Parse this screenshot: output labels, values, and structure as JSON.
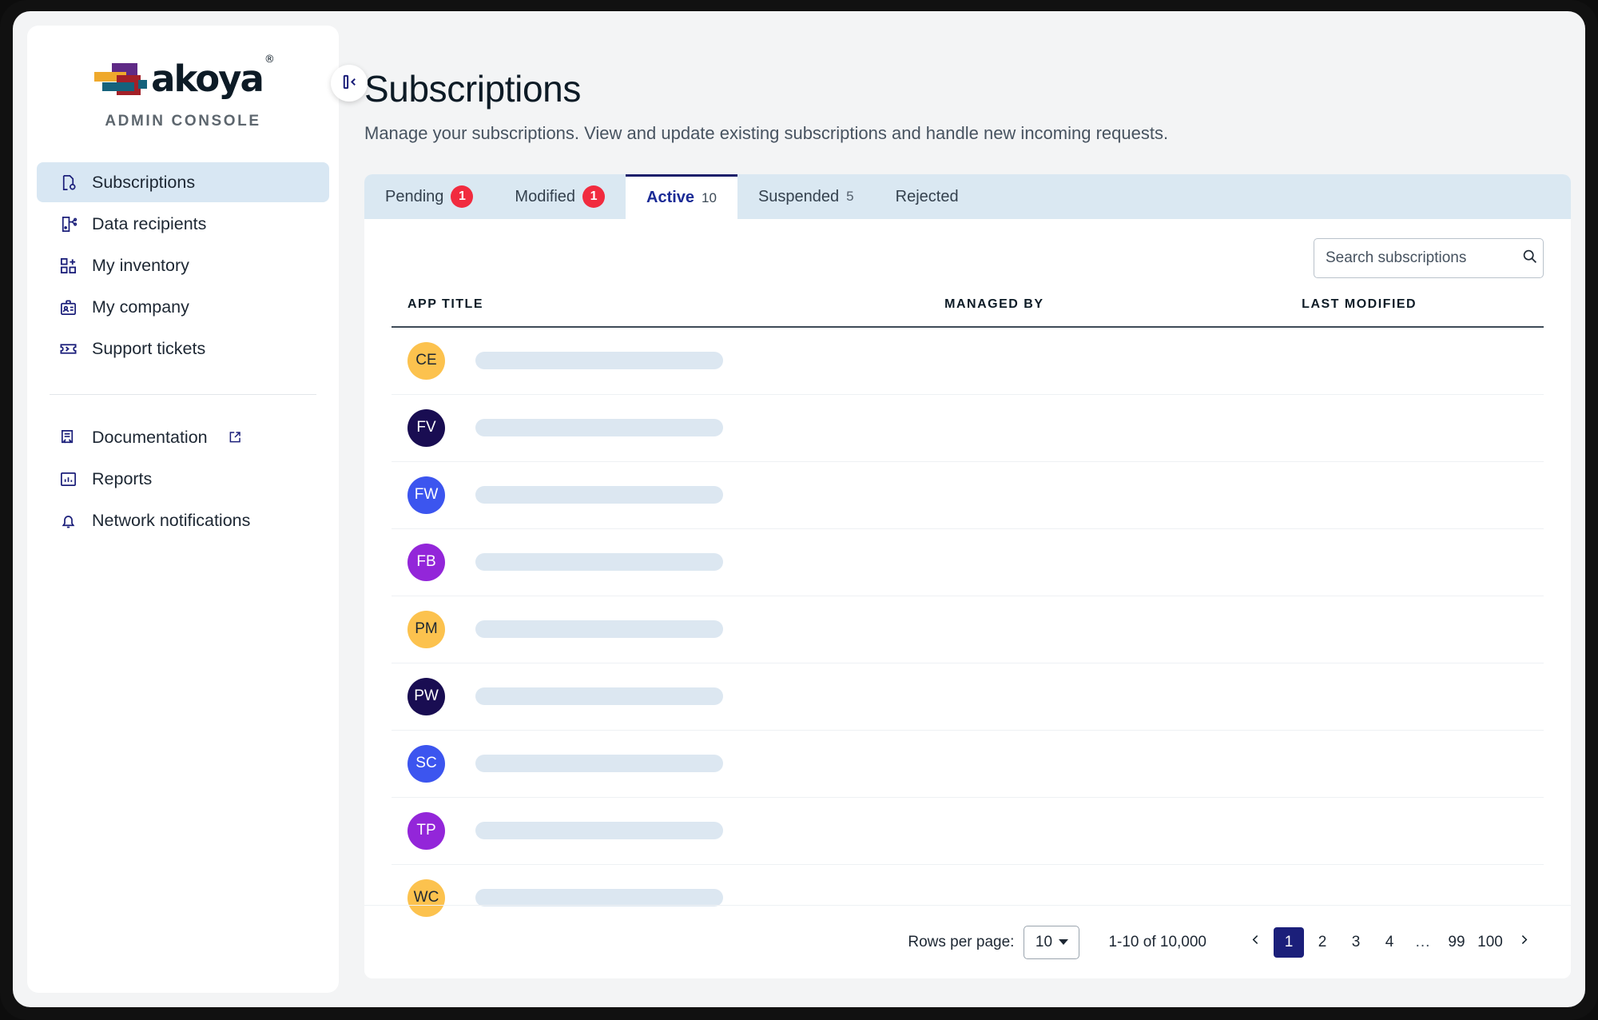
{
  "brand": {
    "logo_word": "akoya",
    "logo_trademark": "®",
    "subtitle": "ADMIN CONSOLE",
    "colors": {
      "purple": "#5f2a86",
      "orange": "#efa92c",
      "red": "#a32028",
      "teal": "#15627c",
      "navy": "#1b1f7a",
      "accent_tab_bg": "#dae8f2",
      "badge_red": "#f12b3f",
      "skeleton": "#dce7f1"
    }
  },
  "sidebar": {
    "collapse_button": "collapse-sidebar",
    "primary_items": [
      {
        "label": "Subscriptions",
        "icon": "subscriptions-icon",
        "active": true
      },
      {
        "label": "Data recipients",
        "icon": "data-recipients-icon",
        "active": false
      },
      {
        "label": "My inventory",
        "icon": "inventory-icon",
        "active": false
      },
      {
        "label": "My company",
        "icon": "company-badge-icon",
        "active": false
      },
      {
        "label": "Support tickets",
        "icon": "ticket-icon",
        "active": false
      }
    ],
    "secondary_items": [
      {
        "label": "Documentation",
        "icon": "documentation-icon",
        "external": true
      },
      {
        "label": "Reports",
        "icon": "reports-chart-icon",
        "external": false
      },
      {
        "label": "Network notifications",
        "icon": "bell-icon",
        "external": false
      }
    ]
  },
  "header": {
    "title": "Subscriptions",
    "subtitle": "Manage your subscriptions. View and update existing subscriptions and handle new incoming requests."
  },
  "tabs": [
    {
      "label": "Pending",
      "badge": "1",
      "badge_style": "red",
      "selected": false
    },
    {
      "label": "Modified",
      "badge": "1",
      "badge_style": "red",
      "selected": false
    },
    {
      "label": "Active",
      "badge": "10",
      "badge_style": "plain",
      "selected": true
    },
    {
      "label": "Suspended",
      "badge": "5",
      "badge_style": "plain",
      "selected": false
    },
    {
      "label": "Rejected",
      "badge": "",
      "badge_style": "none",
      "selected": false
    }
  ],
  "search": {
    "placeholder": "Search subscriptions",
    "value": "",
    "icon": "search-icon"
  },
  "table": {
    "columns": [
      "APP TITLE",
      "MANAGED BY",
      "LAST MODIFIED"
    ],
    "rows": [
      {
        "initials": "CE",
        "avatar_color": "#fcc24e",
        "avatar_text_color": "#1d2733"
      },
      {
        "initials": "FV",
        "avatar_color": "#190d52",
        "avatar_text_color": "#ffffff"
      },
      {
        "initials": "FW",
        "avatar_color": "#3c55ef",
        "avatar_text_color": "#ffffff"
      },
      {
        "initials": "FB",
        "avatar_color": "#9326d9",
        "avatar_text_color": "#ffffff"
      },
      {
        "initials": "PM",
        "avatar_color": "#fcc24e",
        "avatar_text_color": "#1d2733"
      },
      {
        "initials": "PW",
        "avatar_color": "#190d52",
        "avatar_text_color": "#ffffff"
      },
      {
        "initials": "SC",
        "avatar_color": "#3c55ef",
        "avatar_text_color": "#ffffff"
      },
      {
        "initials": "TP",
        "avatar_color": "#9326d9",
        "avatar_text_color": "#ffffff"
      },
      {
        "initials": "WC",
        "avatar_color": "#fcc24e",
        "avatar_text_color": "#1d2733"
      }
    ]
  },
  "pagination": {
    "rows_per_page_label": "Rows per page:",
    "rows_per_page_value": "10",
    "range_text": "1-10 of 10,000",
    "prev_icon": "chevron-left-icon",
    "next_icon": "chevron-right-icon",
    "pages": [
      "1",
      "2",
      "3",
      "4",
      "...",
      "99",
      "100"
    ],
    "active_page": "1"
  }
}
